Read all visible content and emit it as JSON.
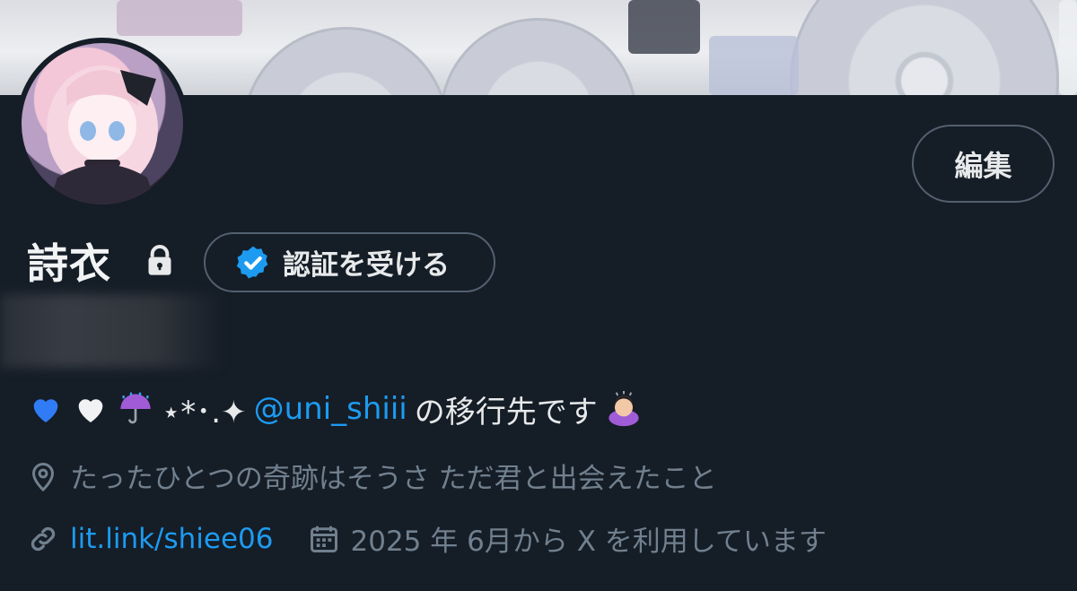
{
  "profile": {
    "display_name": "詩衣",
    "edit_button_label": "編集",
    "verify_button_label": "認証を受ける",
    "bio": {
      "emoji_1": "💙",
      "emoji_2": "🤍",
      "emoji_3": "☔",
      "decoration": "⋆*･.✦",
      "mention": "@uni_shiii",
      "suffix": "の移行先です",
      "emoji_4": "🙇"
    },
    "location": "たったひとつの奇跡はそうさ ただ君と出会えたこと",
    "link": "lit.link/shiee06",
    "joined": "2025 年 6月から X を利用しています"
  },
  "colors": {
    "background": "#151d27",
    "accent_blue": "#1d9bf0",
    "muted_text": "#71808e",
    "button_border": "#52606f"
  },
  "icons": {
    "lock": "lock-icon",
    "verified": "verified-badge-icon",
    "location": "location-pin-icon",
    "link": "link-icon",
    "calendar": "calendar-icon"
  }
}
